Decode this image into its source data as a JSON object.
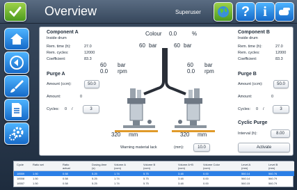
{
  "header": {
    "title": "Overview",
    "user": "Superuser"
  },
  "colour": {
    "label": "Colour",
    "value": "0.0",
    "unit": "%"
  },
  "component_a": {
    "title": "Component A",
    "subtitle": "Inside drum",
    "rem_time_label": "Rem. time (h):",
    "rem_time": "27.0",
    "rem_cycles_label": "Rem. cycles:",
    "rem_cycles": "12000",
    "coefficient_label": "Coefficient:",
    "coefficient": "83.3"
  },
  "component_b": {
    "title": "Component B",
    "subtitle": "Inside drum",
    "rem_time_label": "Rem. time (h):",
    "rem_time": "27.0",
    "rem_cycles_label": "Rem. cycles:",
    "rem_cycles": "12000",
    "coefficient_label": "Coefficient:",
    "coefficient": "83.3"
  },
  "purge_a": {
    "title": "Purge A",
    "amount_ccm_label": "Amount (ccm):",
    "amount_ccm": "50.0",
    "amount_label": "Amount:",
    "amount": "0",
    "cycles_label": "Cycles:",
    "cycles": "0",
    "sep": "/",
    "cycles_target": "3"
  },
  "purge_b": {
    "title": "Purge B",
    "amount_ccm_label": "Amount (ccm):",
    "amount_ccm": "50.0",
    "amount_label": "Amount:",
    "amount": "0",
    "cycles_label": "Cycles:",
    "cycles": "0",
    "sep": "/",
    "cycles_target": "3"
  },
  "cyclic_purge": {
    "title": "Cyclic Purge",
    "interval_label": "Interval (h):",
    "interval": "8.00",
    "activate_label": "Activate"
  },
  "pump_a": {
    "pressure_top": "60",
    "pressure_top_unit": "bar",
    "pressure": "60",
    "pressure_unit": "bar",
    "speed": "0.0",
    "speed_unit": "rpm",
    "stroke": "320",
    "stroke_unit": "mm"
  },
  "pump_b": {
    "pressure_top": "60",
    "pressure_top_unit": "bar",
    "pressure": "60",
    "pressure_unit": "bar",
    "speed": "0.0",
    "speed_unit": "rpm",
    "stroke": "320",
    "stroke_unit": "mm"
  },
  "warning": {
    "label": "Warning material lack",
    "unit": "(mm):",
    "value": "10.0"
  },
  "table": {
    "headers": [
      "Cycle",
      "Ratio set",
      "Ratio actual",
      "Dosing-time (s)",
      "Volume A (ccm)",
      "Volume B (ccm)",
      "Volume A+B (ccm)",
      "Volume Color (ccm)",
      "Level A (mm)",
      "Level B (mm)"
    ],
    "rows": [
      [
        "18559",
        "1.50",
        "0.58",
        "5.25",
        "1.74",
        "5.75",
        "3.48",
        "0.00",
        "560.14",
        "560.76"
      ],
      [
        "18558",
        "1.50",
        "0.58",
        "5.25",
        "1.74",
        "5.75",
        "3.48",
        "0.00",
        "560.14",
        "560.79"
      ],
      [
        "18557",
        "1.50",
        "0.58",
        "5.25",
        "1.74",
        "5.75",
        "3.48",
        "0.00",
        "560.15",
        "560.79"
      ]
    ]
  },
  "colors": {
    "accent_blue": "#2b7fe6",
    "button_green": "#6ab82e",
    "header_dark": "#3a4b60"
  }
}
